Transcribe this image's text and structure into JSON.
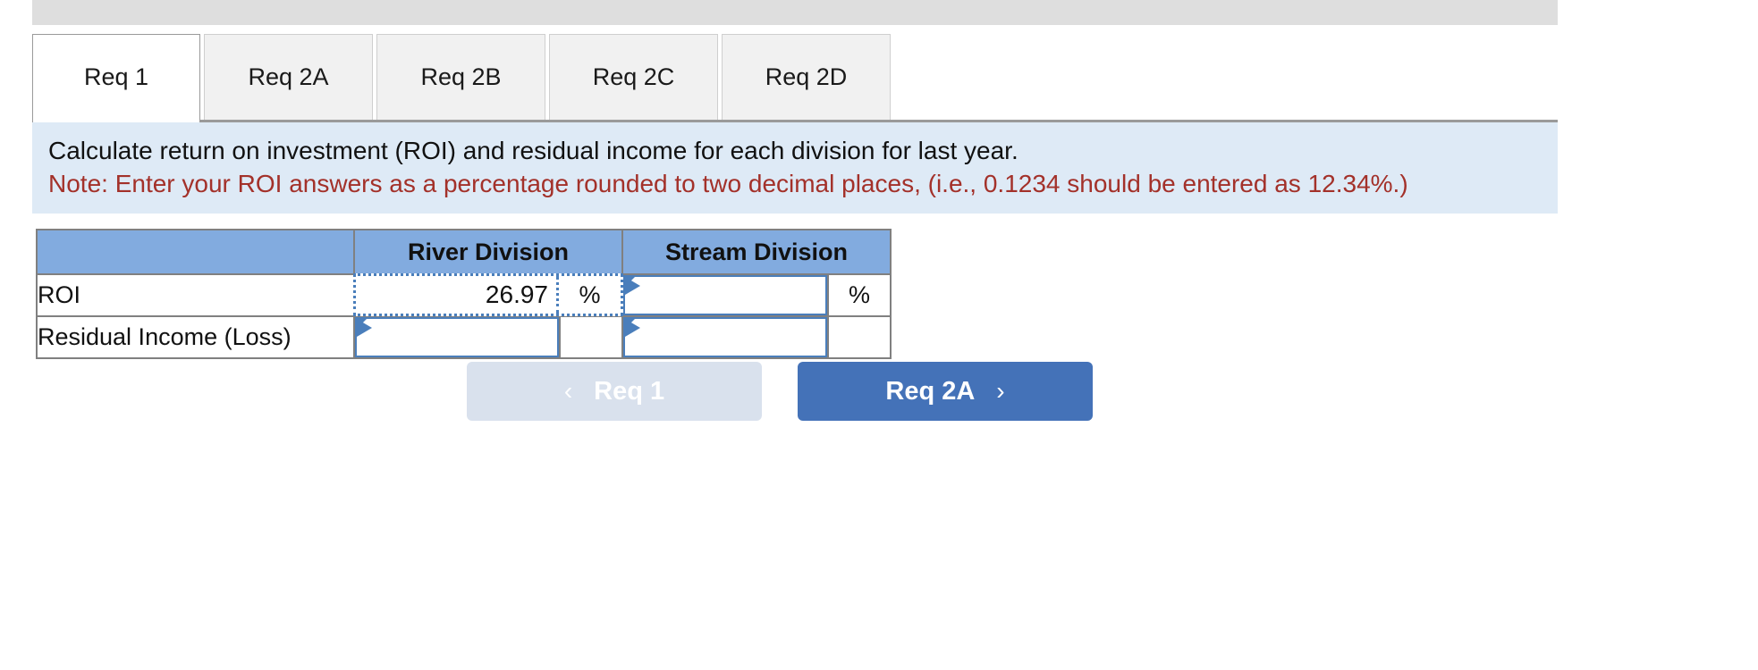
{
  "window": {
    "toolbar_strip": ""
  },
  "tabs": [
    {
      "label": "Req 1",
      "active": true
    },
    {
      "label": "Req 2A",
      "active": false
    },
    {
      "label": "Req 2B",
      "active": false
    },
    {
      "label": "Req 2C",
      "active": false
    },
    {
      "label": "Req 2D",
      "active": false
    }
  ],
  "instruction": {
    "line1": "Calculate return on investment (ROI) and residual income for each division for last year.",
    "line2": "Note: Enter your ROI answers as a percentage rounded to two decimal places, (i.e., 0.1234 should be entered as 12.34%.)",
    "note_color": "#a3312a",
    "background": "#deeaf6"
  },
  "table": {
    "header_background": "#82abdf",
    "columns": [
      {
        "label": ""
      },
      {
        "label": "River Division"
      },
      {
        "label": "Stream Division"
      }
    ],
    "rows": [
      {
        "label": "ROI",
        "river": {
          "value": "26.97",
          "unit": "%",
          "selected": true,
          "empty": false
        },
        "stream": {
          "value": "",
          "unit": "%",
          "selected": false,
          "empty": true
        }
      },
      {
        "label": "Residual Income (Loss)",
        "river": {
          "value": "",
          "unit": "",
          "selected": false,
          "empty": true
        },
        "stream": {
          "value": "",
          "unit": "",
          "selected": false,
          "empty": true
        }
      }
    ]
  },
  "nav": {
    "prev": {
      "label": "Req 1",
      "icon": "chevron-left-icon",
      "glyph": "‹",
      "enabled": false,
      "color": "#d9e1ed"
    },
    "next": {
      "label": "Req 2A",
      "icon": "chevron-right-icon",
      "glyph": "›",
      "enabled": true,
      "color": "#4472b8"
    }
  }
}
